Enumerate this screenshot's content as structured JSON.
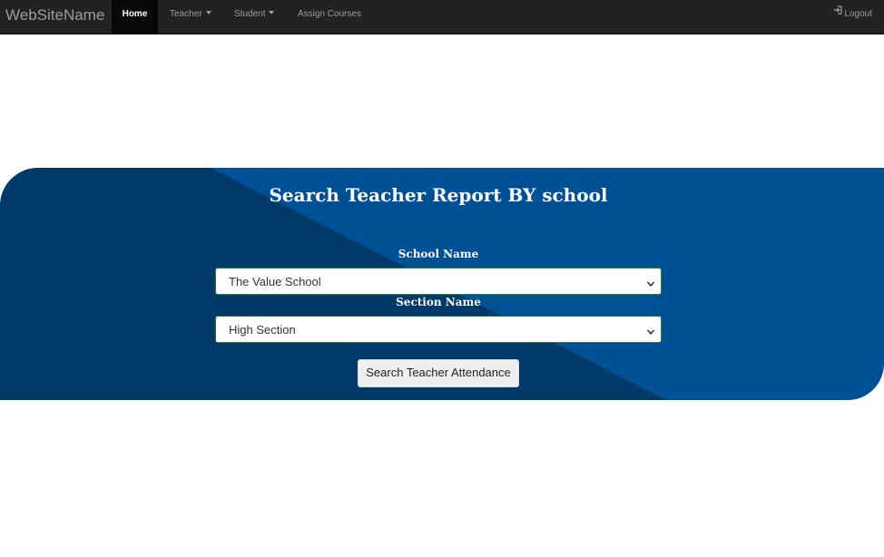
{
  "navbar": {
    "brand": "WebSiteName",
    "items": [
      {
        "label": "Home"
      },
      {
        "label": "Teacher"
      },
      {
        "label": "Student"
      },
      {
        "label": "Assign Courses"
      }
    ],
    "logout_label": "Logout"
  },
  "form": {
    "title": "Search Teacher Report BY school",
    "school_label": "School Name",
    "school_value": "The Value School",
    "section_label": "Section Name",
    "section_value": "High Section",
    "submit_label": "Search Teacher Attendance"
  },
  "colors": {
    "banner_light": "#005096",
    "banner_dark": "#003a6b",
    "navbar_bg": "#222222"
  }
}
